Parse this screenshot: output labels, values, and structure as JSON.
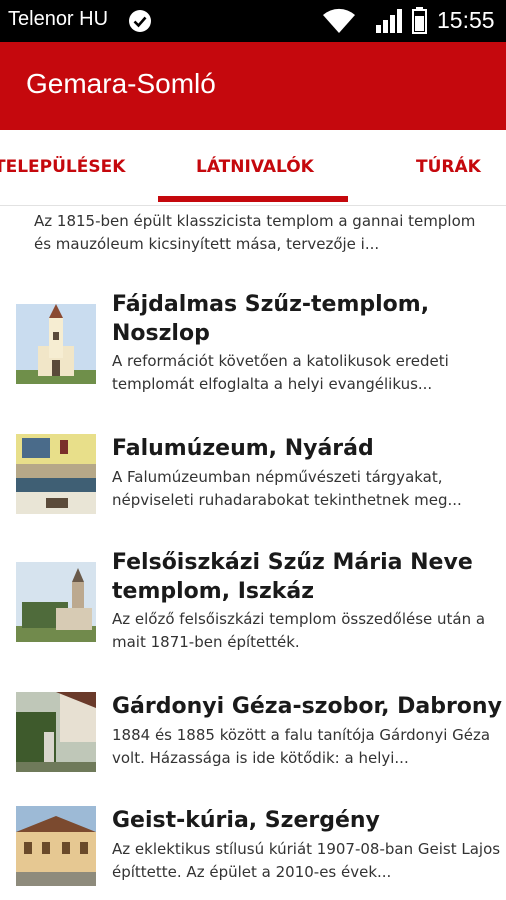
{
  "status": {
    "carrier": "Telenor HU",
    "time": "15:55"
  },
  "app": {
    "title": "Gemara-Somló"
  },
  "tabs": [
    "TELEPÜLÉSEK",
    "LÁTNIVALÓK",
    "TÚRÁK"
  ],
  "partial_item": {
    "description": "Az 1815-ben épült klasszicista templom a gannai templom és mauzóleum kicsinyített mása, tervezője i..."
  },
  "items": [
    {
      "title": "Fájdalmas Szűz-templom, Noszlop",
      "description": "A reformációt követően a katolikusok eredeti templomát elfoglalta a helyi evangélikus..."
    },
    {
      "title": "Falumúzeum, Nyárád",
      "description": "A Falumúzeumban népművészeti tárgyakat, népviseleti ruhadarabokat tekinthetnek meg..."
    },
    {
      "title": "Felsőiszkázi Szűz Mária Neve templom, Iszkáz",
      "description": "Az előző felsőiszkázi templom összedőlése után a mait 1871-ben építették."
    },
    {
      "title": "Gárdonyi Géza-szobor, Dabrony",
      "description": "1884 és 1885 között a falu tanítója Gárdonyi Géza volt. Házassága is ide kötődik: a helyi..."
    },
    {
      "title": "Geist-kúria, Szergény",
      "description": "Az eklektikus stílusú kúriát 1907-08-ban Geist Lajos építtette. Az épület a 2010-es évek..."
    }
  ],
  "colors": {
    "primary": "#c5080d",
    "status_bar": "#000000",
    "text": "#1a1a1a"
  }
}
